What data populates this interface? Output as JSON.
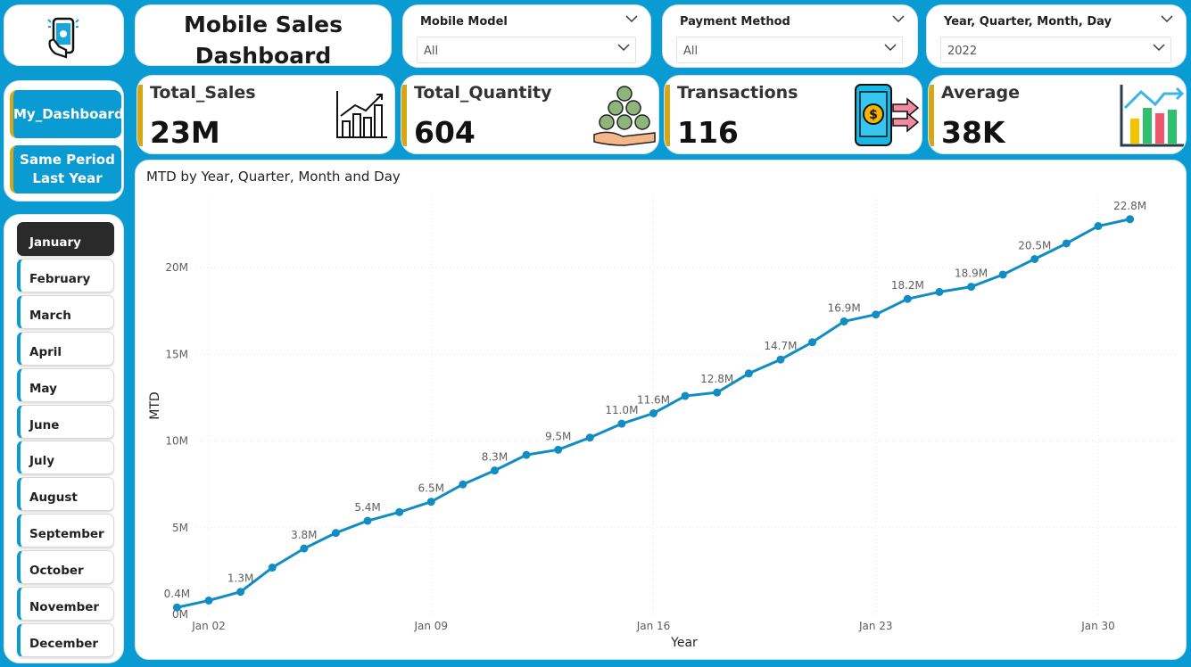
{
  "header": {
    "title_line1": "Mobile Sales",
    "title_line2": "Dashboard"
  },
  "slicers": {
    "model": {
      "label": "Mobile Model",
      "value": "All"
    },
    "payment": {
      "label": "Payment Method",
      "value": "All"
    },
    "date": {
      "label": "Year, Quarter, Month, Day",
      "value": "2022"
    }
  },
  "nav": {
    "dashboard": "My_Dashboard",
    "spl_line1": "Same Period",
    "spl_line2": "Last Year"
  },
  "months": [
    "January",
    "February",
    "March",
    "April",
    "May",
    "June",
    "July",
    "August",
    "September",
    "October",
    "November",
    "December"
  ],
  "active_month": "January",
  "kpis": {
    "sales": {
      "label": "Total_Sales",
      "value": "23M"
    },
    "quantity": {
      "label": "Total_Quantity",
      "value": "604"
    },
    "transactions": {
      "label": "Transactions",
      "value": "116"
    },
    "average": {
      "label": "Average",
      "value": "38K"
    }
  },
  "colors": {
    "accent": "#0b9bd3",
    "kpi_bar": "#d6a715",
    "line": "#118dc4"
  },
  "chart_data": {
    "type": "line",
    "title": "MTD by Year, Quarter, Month and Day",
    "xlabel": "Year",
    "ylabel": "MTD",
    "x_tick_labels": [
      "Jan 02",
      "Jan 09",
      "Jan 16",
      "Jan 23",
      "Jan 30"
    ],
    "y_tick_labels": [
      "0M",
      "5M",
      "10M",
      "15M",
      "20M"
    ],
    "ylim": [
      0,
      25
    ],
    "grid": true,
    "days": [
      1,
      2,
      3,
      4,
      5,
      6,
      7,
      8,
      9,
      10,
      11,
      12,
      13,
      14,
      15,
      16,
      17,
      18,
      19,
      20,
      21,
      22,
      23,
      24,
      25,
      26,
      27,
      28,
      29,
      30,
      31
    ],
    "series": [
      {
        "values": [
          0.4,
          0.8,
          1.3,
          2.7,
          3.8,
          4.7,
          5.4,
          5.9,
          6.5,
          7.5,
          8.3,
          9.2,
          9.5,
          10.2,
          11.0,
          11.6,
          12.6,
          12.8,
          13.9,
          14.7,
          15.7,
          16.9,
          17.3,
          18.2,
          18.6,
          18.9,
          19.6,
          20.5,
          21.4,
          22.4,
          22.8
        ]
      }
    ],
    "data_labels": [
      {
        "day": 1,
        "text": "0.4M"
      },
      {
        "day": 3,
        "text": "1.3M"
      },
      {
        "day": 5,
        "text": "3.8M"
      },
      {
        "day": 7,
        "text": "5.4M"
      },
      {
        "day": 9,
        "text": "6.5M"
      },
      {
        "day": 11,
        "text": "8.3M"
      },
      {
        "day": 13,
        "text": "9.5M"
      },
      {
        "day": 15,
        "text": "11.0M"
      },
      {
        "day": 16,
        "text": "11.6M"
      },
      {
        "day": 18,
        "text": "12.8M"
      },
      {
        "day": 20,
        "text": "14.7M"
      },
      {
        "day": 22,
        "text": "16.9M"
      },
      {
        "day": 24,
        "text": "18.2M"
      },
      {
        "day": 26,
        "text": "18.9M"
      },
      {
        "day": 28,
        "text": "20.5M"
      },
      {
        "day": 31,
        "text": "22.8M"
      }
    ]
  }
}
